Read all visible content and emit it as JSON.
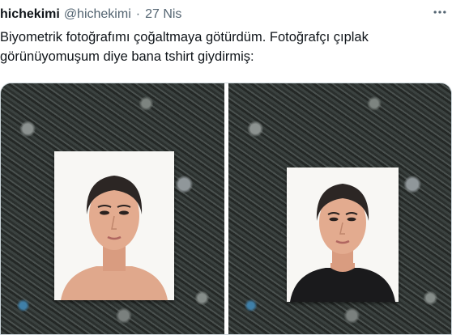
{
  "tweet": {
    "display_name": "hichekimi",
    "handle": "@hichekimi",
    "separator": "·",
    "date": "27 Nis",
    "text": "Biyometrik fotoğrafımı çoğaltmaya götürdüm. Fotoğrafçı çıplak görünüyomuşum diye bana tshirt giydirmiş:"
  },
  "icons": {
    "more": "more-horizontal-icon"
  },
  "colors": {
    "text": "#0f1419",
    "secondary": "#536471",
    "border": "#cfd9de"
  }
}
